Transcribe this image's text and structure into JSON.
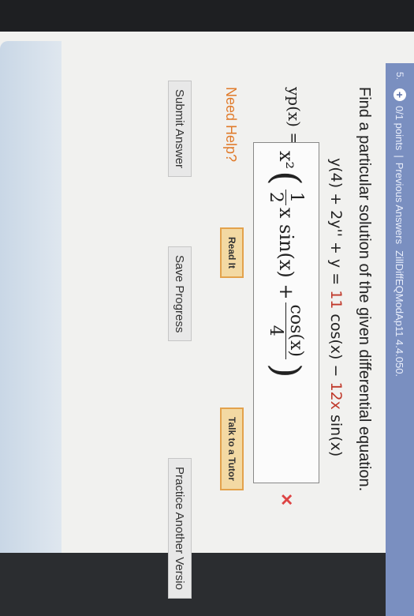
{
  "header": {
    "question_number": "5.",
    "points": "0/1 points",
    "separator": "|",
    "previous_answers": "Previous Answers",
    "reference": "ZillDiffEQModAp11 4.4.050."
  },
  "question": {
    "prompt": "Find a particular solution of the given differential equation.",
    "eq_lhs": "y(4) + 2y'' + y =",
    "eq_coef1": "11",
    "eq_mid": "cos(x) −",
    "eq_coef2": "12x",
    "eq_end": "sin(x)"
  },
  "answer": {
    "label": "yp(x) =",
    "x2": "x²",
    "half_num": "1",
    "half_den": "2",
    "xsin": "x sin(x) +",
    "cos_num": "cos(x)",
    "cos_den": "4",
    "status_icon": "×"
  },
  "help": {
    "label": "Need Help?",
    "read_it": "Read It",
    "talk_tutor": "Talk to a Tutor"
  },
  "actions": {
    "submit": "Submit Answer",
    "save": "Save Progress",
    "practice": "Practice Another Versio"
  }
}
